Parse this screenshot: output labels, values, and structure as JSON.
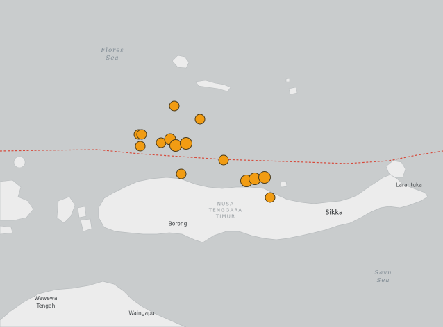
{
  "map": {
    "colors": {
      "sea": "#c9cccd",
      "land": "#ececec",
      "coast": "#b8bcbe",
      "fault": "#d64a3b",
      "quake_fill": "#f19c13",
      "quake_stroke": "#4a3a1a"
    },
    "labels": {
      "flores_sea": "Flores Sea",
      "savu_sea": "Savu Sea",
      "nusa_tenggara_timur": "NUSA TENGGARA TIMUR",
      "borong": "Borong",
      "sikka": "Sikka",
      "larantuka": "Larantuka",
      "wewewa_tengah": "Wewewa Tengah",
      "waingapu": "Waingapu"
    }
  },
  "earthquakes": [
    {
      "id": "q1",
      "size": "md"
    },
    {
      "id": "q2",
      "size": "md"
    },
    {
      "id": "q3",
      "size": "md"
    },
    {
      "id": "q4",
      "size": "md"
    },
    {
      "id": "q5",
      "size": "md"
    },
    {
      "id": "q6",
      "size": "lg"
    },
    {
      "id": "q7",
      "size": "lg"
    },
    {
      "id": "q8",
      "size": "lg"
    },
    {
      "id": "q9",
      "size": "md"
    },
    {
      "id": "q10",
      "size": "md"
    },
    {
      "id": "q11",
      "size": "md"
    },
    {
      "id": "q12",
      "size": "md"
    },
    {
      "id": "q13",
      "size": "lg"
    },
    {
      "id": "q14",
      "size": "lg"
    },
    {
      "id": "q15",
      "size": "lg"
    },
    {
      "id": "q16",
      "size": "md"
    }
  ]
}
